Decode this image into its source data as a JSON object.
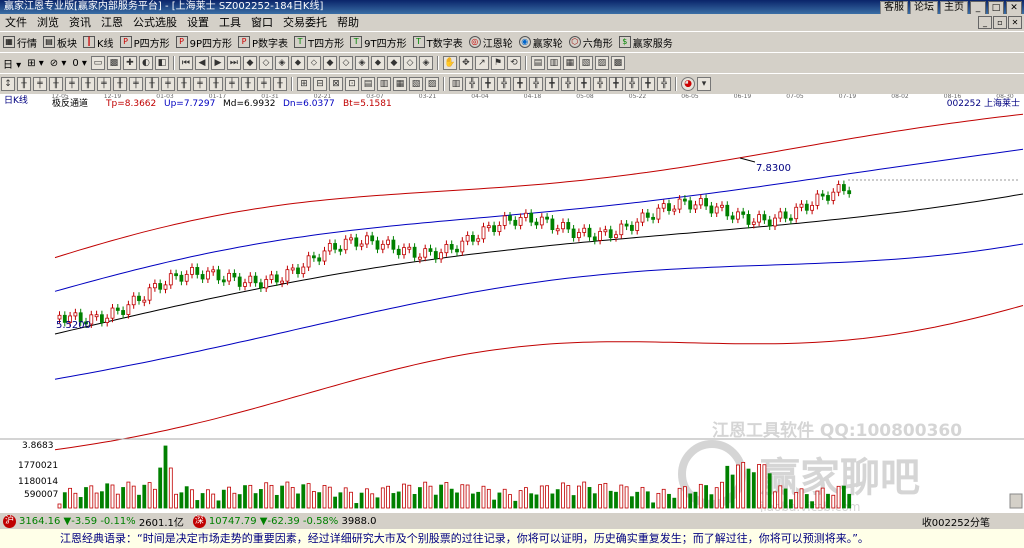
{
  "window": {
    "title": "赢家江恩专业版[赢家内部服务平台] - [上海莱士  SZ002252-184日K线]",
    "links": [
      "客服",
      "论坛",
      "主页"
    ]
  },
  "menu": [
    "文件",
    "浏览",
    "资讯",
    "江恩",
    "公式选股",
    "设置",
    "工具",
    "窗口",
    "交易委托",
    "帮助"
  ],
  "toolbar1": [
    "行情",
    "板块",
    "K线",
    "P四方形",
    "9P四方形",
    "P数字表",
    "T四方形",
    "9T四方形",
    "T数字表",
    "江恩轮",
    "赢家轮",
    "六角形",
    "赢家服务"
  ],
  "chart": {
    "period_label": "日K线",
    "indicator": "极反通道",
    "tp": "Tp=8.3662",
    "up": "Up=7.7297",
    "md": "Md=6.9932",
    "dn": "Dn=6.0377",
    "bt": "Bt=5.1581",
    "stock": "002252 上海莱士",
    "high_label": "7.8300",
    "low_label": "5.5200",
    "date_ticks": [
      "12-05",
      "12-19",
      "01-03",
      "01-17",
      "01-31",
      "02-21",
      "03-07",
      "03-21",
      "04-04",
      "04-18",
      "05-08",
      "05-22",
      "06-05",
      "06-19",
      "07-05",
      "07-19",
      "08-02",
      "08-16",
      "08-30"
    ],
    "volume_ticks": [
      "3.8683",
      "1770021",
      "1180014",
      "590007"
    ],
    "watermark1": "江恩工具软件  QQ:100800360",
    "watermark2": "赢家聊吧",
    "watermark3": "jiaoba.vicsb.com"
  },
  "status": {
    "sh_value": "3164.16",
    "sh_chg": "▼-3.59",
    "sh_pct": "-0.11%",
    "sh_amt": "2601.1亿",
    "sz_value": "10747.79",
    "sz_chg": "▼-62.39",
    "sz_pct": "-0.58%",
    "sz_amt": "3988.0",
    "right_text": "收002252分笔"
  },
  "quote": "江恩经典语录：“时间是决定市场走势的重要因素，经过详细研究大市及个别股票的过往记录，你将可以证明，历史确实重复发生；而了解过往，你将可以预测将来。”。"
}
